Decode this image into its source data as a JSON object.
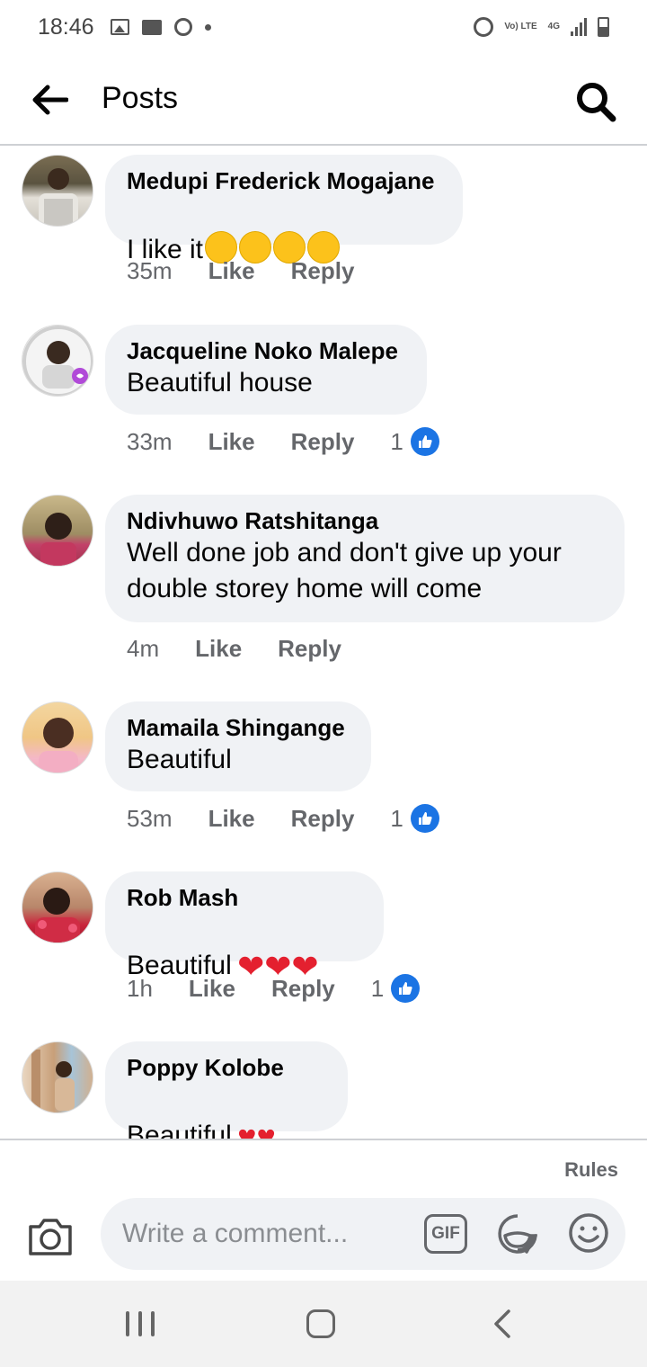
{
  "status_bar": {
    "time": "18:46",
    "left_icons": [
      "image-icon",
      "folder-icon",
      "messenger-icon",
      "dot-icon"
    ],
    "right_icons": [
      "alarm-icon",
      "volte-icon",
      "4g-icon",
      "signal-icon",
      "battery-icon"
    ],
    "volte_label": "Vo) LTE",
    "network_label": "4G"
  },
  "header": {
    "title": "Posts",
    "back_icon": "arrow-left-icon",
    "search_icon": "search-icon"
  },
  "comments": [
    {
      "author": "Medupi Frederick Mogajane",
      "text": "I like it",
      "emojis": [
        "tears-of-joy-emoji",
        "grinning-emoji",
        "heart-eyes-emoji",
        "yum-emoji"
      ],
      "time": "35m",
      "like_label": "Like",
      "reply_label": "Reply",
      "likes": ""
    },
    {
      "author": "Jacqueline Noko Malepe",
      "text": "Beautiful house",
      "time": "33m",
      "like_label": "Like",
      "reply_label": "Reply",
      "likes": "1"
    },
    {
      "author": "Ndivhuwo Ratshitanga",
      "text": "Well done job and don't give up your\ndouble storey home will come",
      "time": "4m",
      "like_label": "Like",
      "reply_label": "Reply",
      "likes": ""
    },
    {
      "author": "Mamaila Shingange",
      "text": "Beautiful",
      "time": "53m",
      "like_label": "Like",
      "reply_label": "Reply",
      "likes": "1"
    },
    {
      "author": "Rob Mash",
      "text": "Beautiful ",
      "hearts": "❤❤❤",
      "time": "1h",
      "like_label": "Like",
      "reply_label": "Reply",
      "likes": "1"
    },
    {
      "author": "Poppy Kolobe",
      "text": "Beautiful ",
      "hearts": "♥♥",
      "time": "",
      "like_label": "",
      "reply_label": "",
      "likes": ""
    }
  ],
  "footer": {
    "rules_label": "Rules",
    "comment_placeholder": "Write a comment...",
    "gif_label": "GIF",
    "camera_icon": "camera-icon",
    "sticker_icon": "sticker-icon",
    "emoji_icon": "smiley-icon"
  },
  "colors": {
    "bubble": "#f0f2f5",
    "like_blue": "#1b74e4",
    "secondary_text": "#65676b",
    "heart_red": "#e4202f"
  }
}
